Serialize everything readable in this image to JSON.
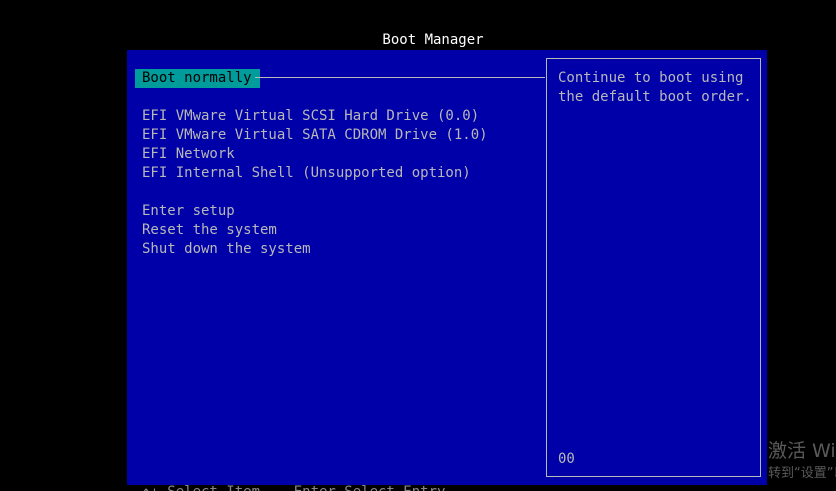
{
  "title": "Boot Manager",
  "menu": {
    "selected": "Boot normally",
    "devices": [
      "EFI VMware Virtual SCSI Hard Drive (0.0)",
      "EFI VMware Virtual SATA CDROM Drive (1.0)",
      "EFI Network",
      "EFI Internal Shell (Unsupported option)"
    ],
    "actions": [
      "Enter setup",
      "Reset the system",
      "Shut down the system"
    ]
  },
  "help": {
    "text": "Continue to boot using the default boot order.",
    "code": "00"
  },
  "bottom_hint": "↑↓ Select Item    Enter Select Entry",
  "watermark": {
    "line1": "激活 Windows",
    "line2": "转到“设置”以激活 Windows。"
  },
  "colors": {
    "background": "#000000",
    "panel": "#0000a8",
    "selection": "#009c9c",
    "text": "#b8b8b8",
    "title": "#ffffff"
  }
}
